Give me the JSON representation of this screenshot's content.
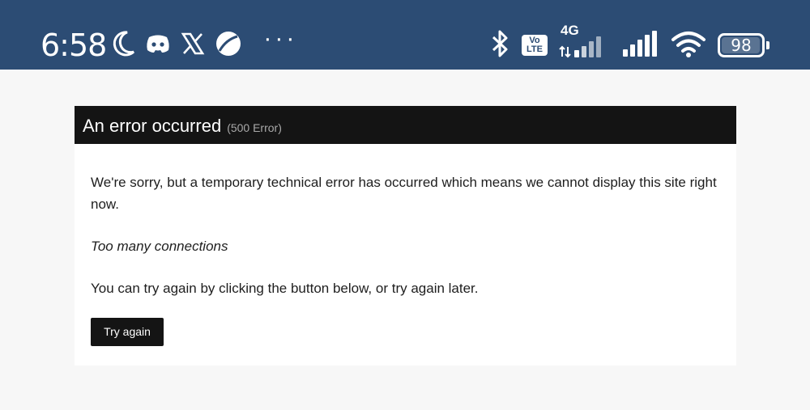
{
  "status_bar": {
    "time": "6:58",
    "notification_icons": [
      "moon-icon",
      "discord-icon",
      "x-icon",
      "browser-icon"
    ],
    "more_glyph": "···",
    "volte_label_top": "Vo",
    "volte_label_bottom": "LTE",
    "network_type": "4G",
    "battery_percent": "98",
    "battery_level": 0.98,
    "background_color": "#2c4c74"
  },
  "error": {
    "title": "An error occurred",
    "code": "(500 Error)",
    "message": "We're sorry, but a temporary technical error has occurred which means we cannot display this site right now.",
    "detail": "Too many connections",
    "hint": "You can try again by clicking the button below, or try again later.",
    "retry_label": "Try again"
  }
}
